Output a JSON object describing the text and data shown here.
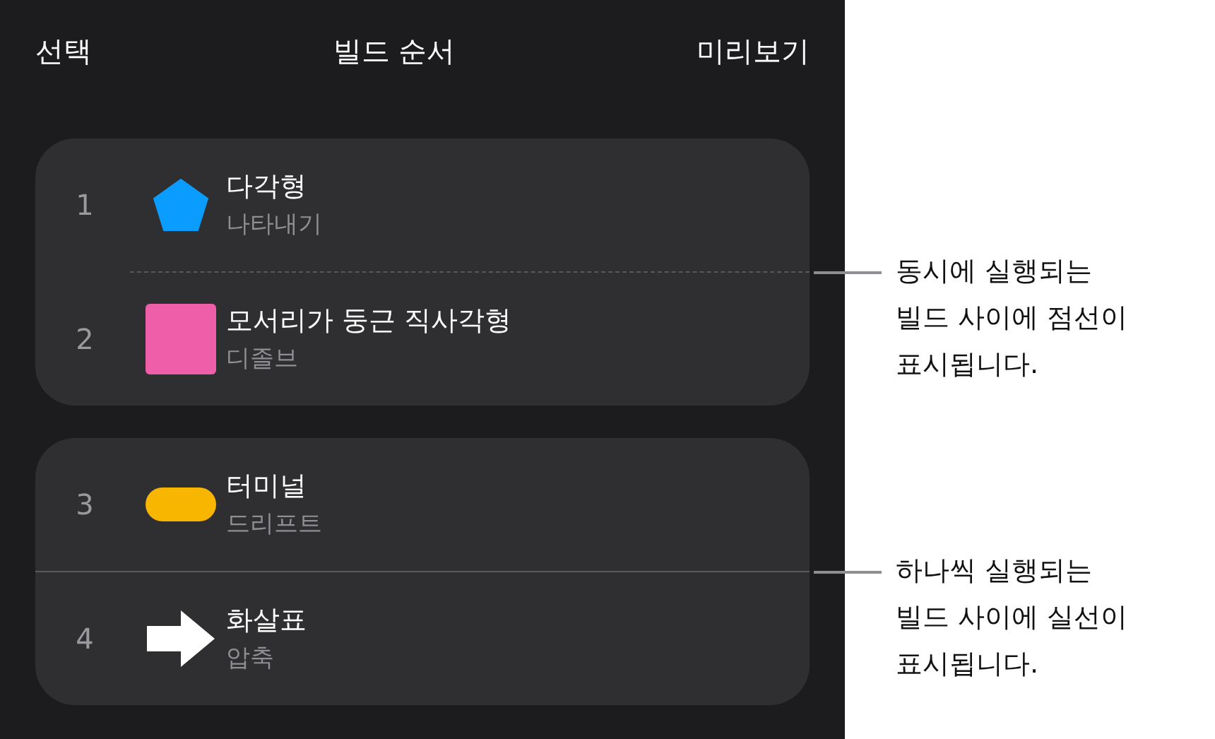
{
  "header": {
    "left": "선택",
    "title": "빌드 순서",
    "right": "미리보기"
  },
  "groups": [
    {
      "divider": {
        "kind": "dashed"
      },
      "callout": [
        "동시에 실행되는",
        "빌드 사이에 점선이",
        "표시됩니다."
      ],
      "builds": [
        {
          "number": "1",
          "name": "다각형",
          "effect": "나타내기",
          "kind": "pentagon",
          "color": "#0a9cff"
        },
        {
          "number": "2",
          "name": "모서리가 둥근 직사각형",
          "effect": "디졸브",
          "kind": "square",
          "color": "#ef5ea8"
        }
      ]
    },
    {
      "divider": {
        "kind": "solid"
      },
      "callout": [
        "하나씩 실행되는",
        "빌드 사이에 실선이",
        "표시됩니다."
      ],
      "builds": [
        {
          "number": "3",
          "name": "터미널",
          "effect": "드리프트",
          "kind": "pill",
          "color": "#f8b600"
        },
        {
          "number": "4",
          "name": "화살표",
          "effect": "압축",
          "kind": "arrow",
          "color": "#ffffff"
        }
      ]
    }
  ]
}
